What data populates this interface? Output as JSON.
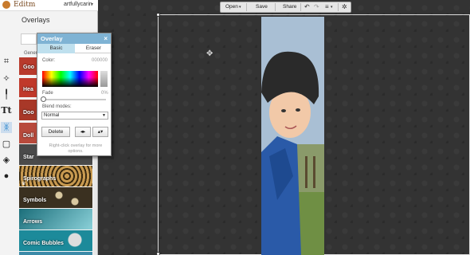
{
  "app": {
    "brand": "Editm",
    "user": "artfullycarin"
  },
  "panel": {
    "title": "Overlays",
    "general_label": "Gener",
    "thumbs": [
      {
        "label": "Goo",
        "color": "#b83a2c"
      },
      {
        "label": "Hea",
        "color": "#c0392b"
      },
      {
        "label": "Doo",
        "color": "#a83828"
      },
      {
        "label": "Doll",
        "color": "#b84a3c"
      },
      {
        "label": "Star",
        "color": "#4a4a4a"
      },
      {
        "label": "Spirographs",
        "color": "#c89a50"
      },
      {
        "label": "Symbols",
        "color": "#3a3020"
      },
      {
        "label": "Arrows",
        "color": "#1b6e7a"
      },
      {
        "label": "Comic Bubbles",
        "color": "#1c8a9a"
      },
      {
        "label": "",
        "color": "#3c8aa8"
      }
    ]
  },
  "toolbar": {
    "open": "Open",
    "save": "Save",
    "share": "Share",
    "undo_icon": "undo-icon",
    "redo_icon": "redo-icon"
  },
  "dialog": {
    "title": "Overlay",
    "close": "×",
    "tab_basic": "Basic",
    "tab_eraser": "Eraser",
    "color_label": "Color:",
    "color_value": "000000",
    "fade_label": "Fade",
    "fade_value": "0%",
    "blend_label": "Blend modes:",
    "blend_value": "Normal",
    "delete": "Delete",
    "flip_h": "◂▸",
    "flip_v": "▴▾",
    "hint": "Right-click overlay for more options."
  }
}
